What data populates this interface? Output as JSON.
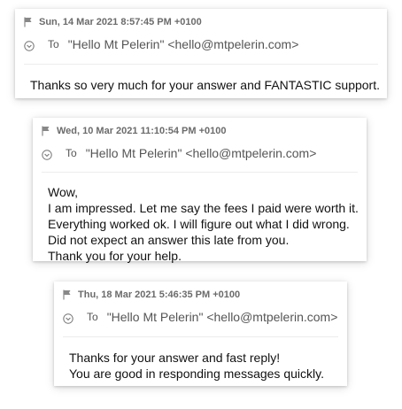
{
  "messages": [
    {
      "date": "Sun, 14 Mar 2021 8:57:45 PM +0100",
      "to_label": "To",
      "to_address": "\"Hello Mt Pelerin\" <hello@mtpelerin.com>",
      "body": [
        "Thanks so very much for your answer and FANTASTIC support."
      ]
    },
    {
      "date": "Wed, 10 Mar 2021 11:10:54 PM +0100",
      "to_label": "To",
      "to_address": "\"Hello Mt Pelerin\" <hello@mtpelerin.com>",
      "body": [
        "Wow,",
        "I am impressed. Let me say the fees I paid were worth it.",
        "Everything worked ok. I will figure out what I did wrong.",
        "Did not expect an answer this late from you.",
        "Thank you for your help."
      ]
    },
    {
      "date": "Thu, 18 Mar 2021 5:46:35 PM +0100",
      "to_label": "To",
      "to_address": "\"Hello Mt Pelerin\" <hello@mtpelerin.com>",
      "body": [
        "Thanks for your answer and fast reply!",
        "You are good in responding messages quickly."
      ]
    }
  ],
  "icons": {
    "flag": "flag-icon",
    "expand": "chevron-down-circle-icon"
  },
  "colors": {
    "meta_text": "#6b6b6b",
    "body_text": "#111111",
    "card_background": "#ffffff"
  }
}
